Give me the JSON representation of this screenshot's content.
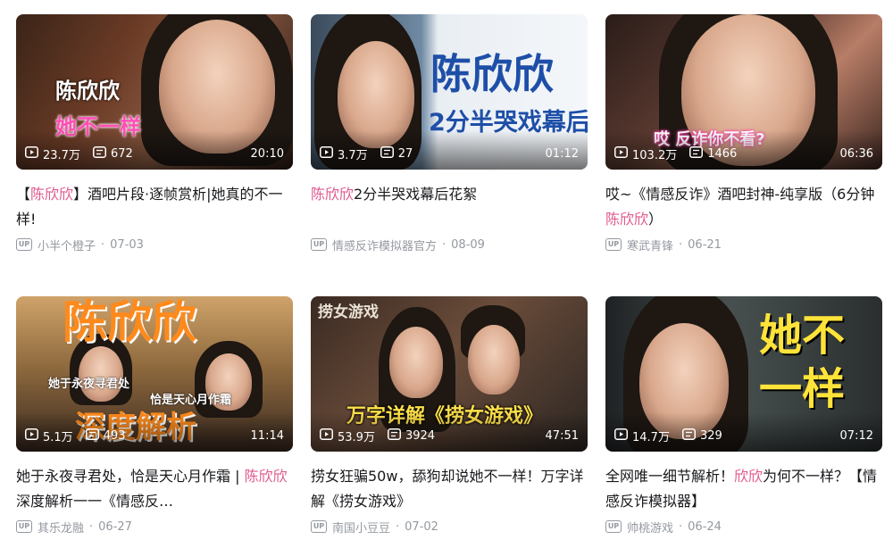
{
  "cards": [
    {
      "thumb_captions": [
        "陈欣欣",
        "她不一样"
      ],
      "views": "23.7万",
      "danmaku": "672",
      "duration": "20:10",
      "title_parts": [
        {
          "text": "【",
          "hl": false
        },
        {
          "text": "陈欣欣",
          "hl": true
        },
        {
          "text": "】酒吧片段·逐帧赏析|她真的不一样!",
          "hl": false
        }
      ],
      "author": "小半个橙子",
      "date": "07-03"
    },
    {
      "thumb_captions": [
        "陈欣欣",
        "2分半哭戏幕后"
      ],
      "views": "3.7万",
      "danmaku": "27",
      "duration": "01:12",
      "title_parts": [
        {
          "text": "陈欣欣",
          "hl": true
        },
        {
          "text": "2分半哭戏幕后花絮",
          "hl": false
        }
      ],
      "author": "情感反诈模拟器官方",
      "date": "08-09"
    },
    {
      "thumb_captions": [
        "哎 反诈你不看?"
      ],
      "views": "103.2万",
      "danmaku": "1466",
      "duration": "06:36",
      "title_parts": [
        {
          "text": "哎~《情感反诈》酒吧封神-纯享版（6分钟",
          "hl": false
        },
        {
          "text": "陈欣欣",
          "hl": true
        },
        {
          "text": "）",
          "hl": false
        }
      ],
      "author": "寒武青锋",
      "date": "06-21"
    },
    {
      "thumb_captions": [
        "陈欣欣",
        "她于永夜寻君处",
        "恰是天心月作霜",
        "深度解析"
      ],
      "views": "5.1万",
      "danmaku": "493",
      "duration": "11:14",
      "title_parts": [
        {
          "text": "她于永夜寻君处，恰是天心月作霜 | ",
          "hl": false
        },
        {
          "text": "陈欣欣",
          "hl": true
        },
        {
          "text": "深度解析一一《情感反…",
          "hl": false
        }
      ],
      "author": "其乐龙融",
      "date": "06-27"
    },
    {
      "thumb_captions": [
        "捞女游戏",
        "万字详解《捞女游戏》"
      ],
      "views": "53.9万",
      "danmaku": "3924",
      "duration": "47:51",
      "title_parts": [
        {
          "text": "捞女狂骗50w，舔狗却说她不一样！万字详解《捞女游戏》",
          "hl": false
        }
      ],
      "author": "南国小豆豆",
      "date": "07-02"
    },
    {
      "thumb_captions": [
        "她不",
        "一样"
      ],
      "views": "14.7万",
      "danmaku": "329",
      "duration": "07:12",
      "title_parts": [
        {
          "text": "全网唯一细节解析！",
          "hl": false
        },
        {
          "text": "欣欣",
          "hl": true
        },
        {
          "text": "为何不一样？【情感反诈模拟器】",
          "hl": false
        }
      ],
      "author": "帅桃游戏",
      "date": "06-24"
    }
  ],
  "up_badge_label": "UP",
  "date_separator": "·",
  "colors": {
    "highlight": "#e05a8f",
    "meta": "#9499a0",
    "title": "#18191c"
  },
  "icons": {
    "views": "play-count-icon",
    "danmaku": "danmaku-icon",
    "uploader": "up-badge-icon"
  }
}
